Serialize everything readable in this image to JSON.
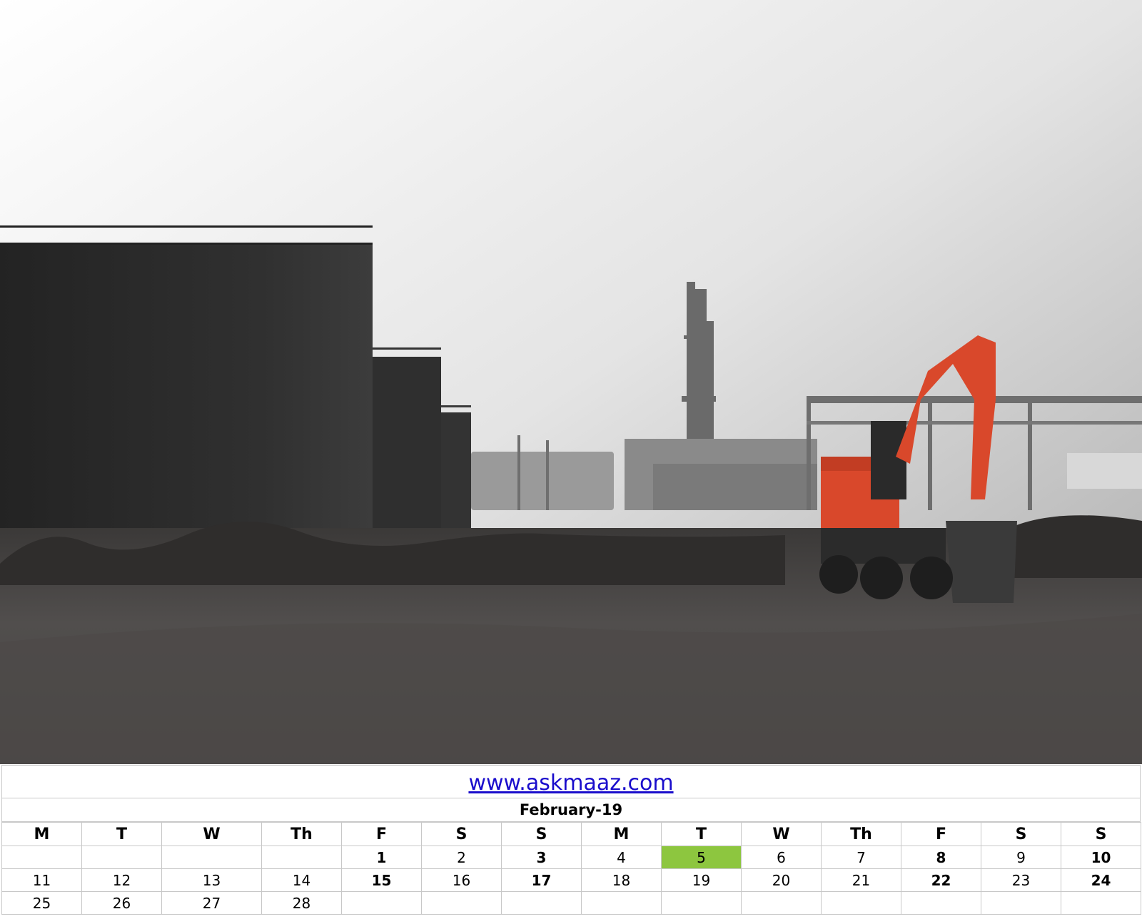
{
  "banner": {
    "description_icons": [
      "storage-tank-icon",
      "excavator-icon",
      "refinery-tower-icon"
    ],
    "colors": {
      "sky": "#dcdcdc",
      "tank": "#2e2e2e",
      "ground": "#4f4d4c",
      "excavator": "#d9482b"
    }
  },
  "calendar": {
    "website": "www.askmaaz.com",
    "month": "February-19",
    "weekdays": [
      {
        "label": "M",
        "kind": "normal"
      },
      {
        "label": "T",
        "kind": "normal"
      },
      {
        "label": "W",
        "kind": "normal"
      },
      {
        "label": "Th",
        "kind": "normal"
      },
      {
        "label": "F",
        "kind": "fri"
      },
      {
        "label": "S",
        "kind": "normal"
      },
      {
        "label": "S",
        "kind": "sun"
      },
      {
        "label": "M",
        "kind": "normal"
      },
      {
        "label": "T",
        "kind": "normal"
      },
      {
        "label": "W",
        "kind": "normal"
      },
      {
        "label": "Th",
        "kind": "normal"
      },
      {
        "label": "F",
        "kind": "fri"
      },
      {
        "label": "S",
        "kind": "normal"
      },
      {
        "label": "S",
        "kind": "sun"
      }
    ],
    "rows": [
      [
        "",
        "",
        "",
        "",
        "1",
        "2",
        "3",
        "4",
        "5",
        "6",
        "7",
        "8",
        "9",
        "10"
      ],
      [
        "11",
        "12",
        "13",
        "14",
        "15",
        "16",
        "17",
        "18",
        "19",
        "20",
        "21",
        "22",
        "23",
        "24"
      ],
      [
        "25",
        "26",
        "27",
        "28",
        "",
        "",
        "",
        "",
        "",
        "",
        "",
        "",
        "",
        ""
      ]
    ],
    "highlight_day": "5",
    "colors": {
      "friday": "#1aa34a",
      "sunday": "#e30c0c",
      "highlight": "#8dc63f",
      "link": "#1a0dcc"
    }
  }
}
